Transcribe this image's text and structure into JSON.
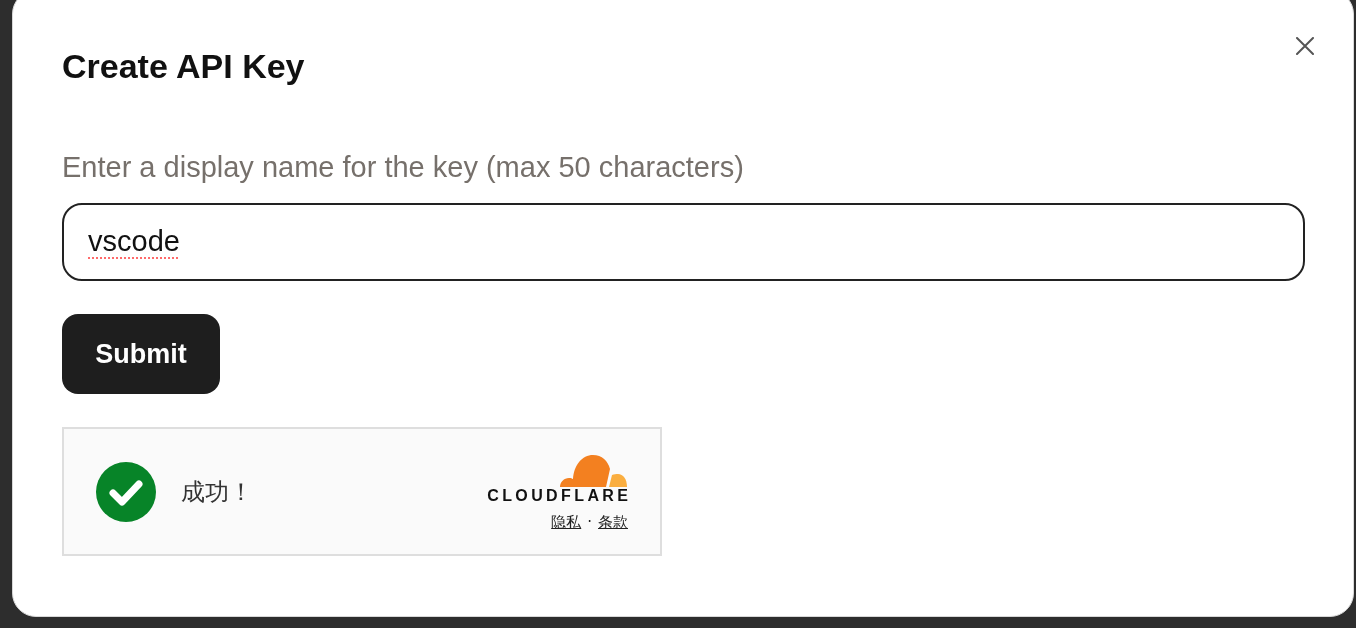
{
  "dialog": {
    "title": "Create API Key"
  },
  "form": {
    "label": "Enter a display name for the key (max 50 characters)",
    "name_input": {
      "value": "vscode",
      "spelling_flagged": true
    },
    "submit_button": "Submit"
  },
  "captcha": {
    "verified": true,
    "status": "成功！",
    "brand": "CLOUDFLARE",
    "links": [
      {
        "label": "隐私"
      },
      {
        "label": "条款"
      }
    ],
    "separator": "·"
  }
}
